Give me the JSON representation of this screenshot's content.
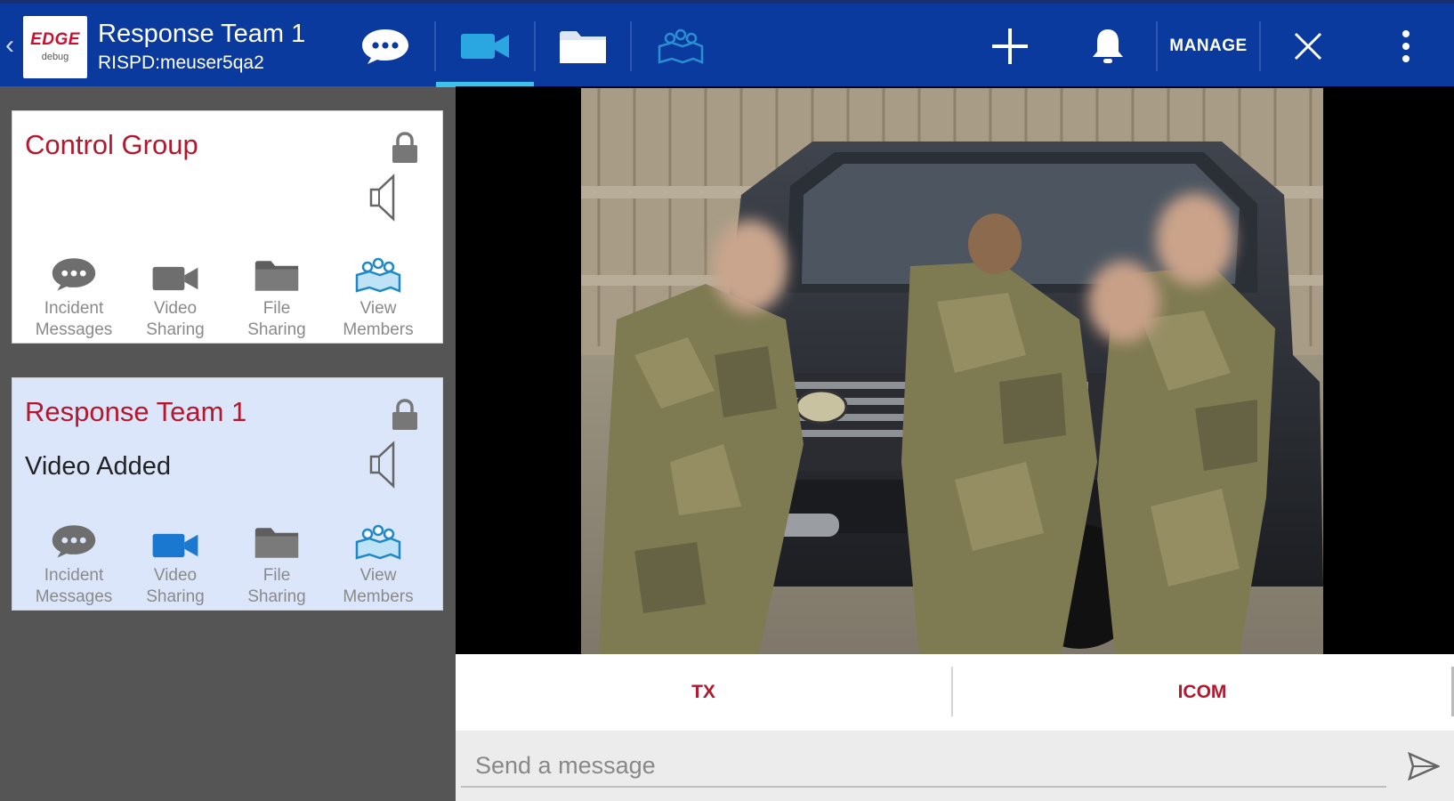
{
  "header": {
    "back_icon": "chevron-left-icon",
    "logo_text": "EDGE",
    "logo_subtext": "debug",
    "title": "Response Team 1",
    "subtitle": "RISPD:meuser5qa2",
    "tabs": [
      {
        "icon": "chat-bubble-icon"
      },
      {
        "icon": "video-camera-icon",
        "selected": true
      },
      {
        "icon": "folder-icon"
      },
      {
        "icon": "members-map-icon"
      }
    ],
    "actions": {
      "add_icon": "plus-icon",
      "notifications_icon": "bell-icon",
      "manage_label": "MANAGE",
      "close_icon": "close-icon",
      "overflow_icon": "more-vert-icon"
    },
    "colors": {
      "bar": "#0b3a9e",
      "accent": "#3ec1ea"
    }
  },
  "groups": [
    {
      "name": "Control Group",
      "status": "",
      "selected": false,
      "actions": [
        {
          "label": "Incident\nMessages",
          "icon": "chat-bubble-icon"
        },
        {
          "label": "Video\nSharing",
          "icon": "video-camera-icon"
        },
        {
          "label": "File\nSharing",
          "icon": "folder-icon"
        },
        {
          "label": "View\nMembers",
          "icon": "members-map-icon"
        }
      ]
    },
    {
      "name": "Response Team 1",
      "status": "Video Added",
      "selected": true,
      "actions": [
        {
          "label": "Incident\nMessages",
          "icon": "chat-bubble-icon"
        },
        {
          "label": "Video\nSharing",
          "icon": "video-camera-icon",
          "active": true
        },
        {
          "label": "File\nSharing",
          "icon": "folder-icon"
        },
        {
          "label": "View\nMembers",
          "icon": "members-map-icon"
        }
      ]
    }
  ],
  "video": {
    "content": "shared-video-frame"
  },
  "ptt": {
    "tx_label": "TX",
    "icom_label": "ICOM"
  },
  "message": {
    "placeholder": "Send a message",
    "send_icon": "send-icon"
  }
}
